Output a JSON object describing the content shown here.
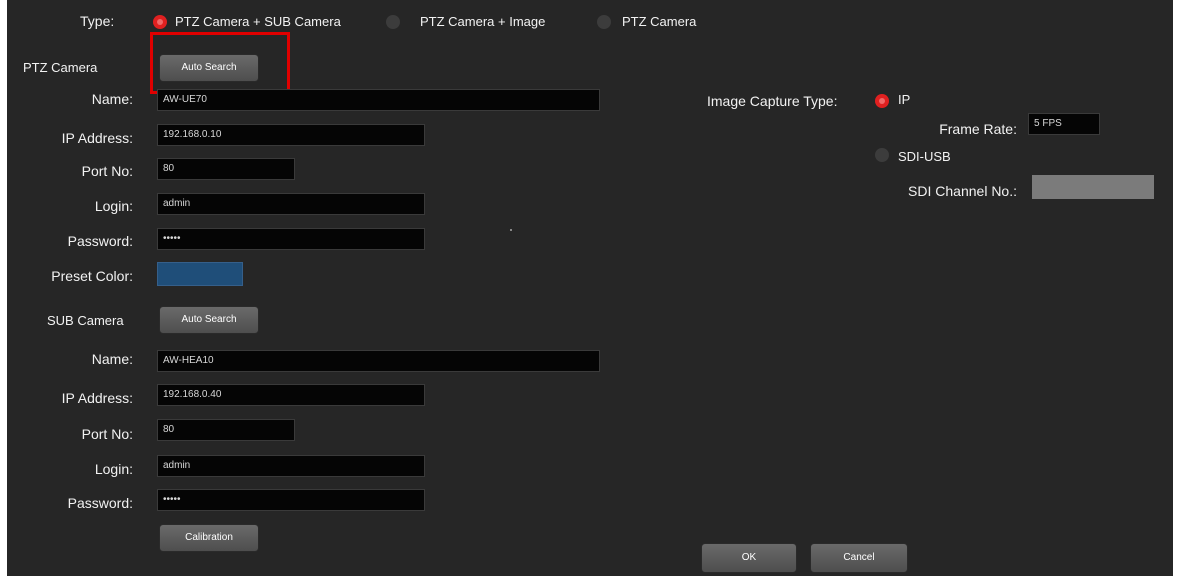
{
  "type_row": {
    "label": "Type:",
    "options": [
      {
        "label": "PTZ Camera + SUB Camera",
        "selected": true
      },
      {
        "label": "PTZ Camera + Image",
        "selected": false
      },
      {
        "label": "PTZ Camera",
        "selected": false
      }
    ]
  },
  "ptz": {
    "section_label": "PTZ Camera",
    "auto_search_label": "Auto Search",
    "name_label": "Name:",
    "name_value": "AW-UE70",
    "ip_label": "IP Address:",
    "ip_value": "192.168.0.10",
    "port_label": "Port No:",
    "port_value": "80",
    "login_label": "Login:",
    "login_value": "admin",
    "password_label": "Password:",
    "password_value": "•••••",
    "preset_color_label": "Preset Color:",
    "preset_color": "#1f4e79"
  },
  "sub": {
    "section_label": "SUB Camera",
    "auto_search_label": "Auto Search",
    "name_label": "Name:",
    "name_value": "AW-HEA10",
    "ip_label": "IP Address:",
    "ip_value": "192.168.0.40",
    "port_label": "Port No:",
    "port_value": "80",
    "login_label": "Login:",
    "login_value": "admin",
    "password_label": "Password:",
    "password_value": "•••••",
    "calibration_label": "Calibration"
  },
  "image_capture": {
    "type_label": "Image Capture Type:",
    "ip_option": {
      "label": "IP",
      "selected": true
    },
    "frame_rate_label": "Frame Rate:",
    "frame_rate_value": "5 FPS",
    "sdi_option": {
      "label": "SDI-USB",
      "selected": false
    },
    "sdi_channel_label": "SDI Channel No.:",
    "sdi_channel_value": ""
  },
  "footer": {
    "ok_label": "OK",
    "cancel_label": "Cancel"
  },
  "colors": {
    "background": "#262626",
    "field_bg": "#050505",
    "radio_selected": "#e02020",
    "highlight_border": "#e00000"
  }
}
